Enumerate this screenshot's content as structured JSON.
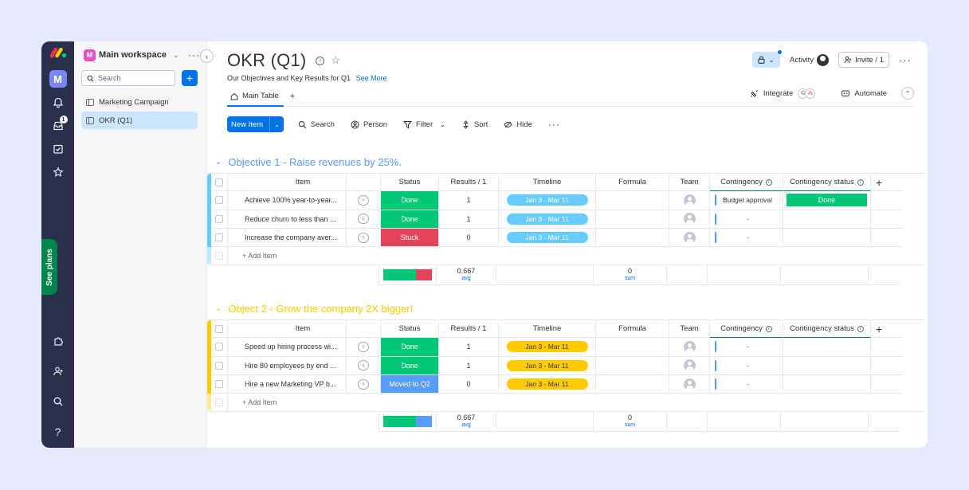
{
  "workspace": {
    "name": "Main workspace",
    "avatar_letter": "M",
    "search_placeholder": "Search",
    "boards": [
      {
        "label": "Marketing Campaign",
        "active": false
      },
      {
        "label": "OKR (Q1)",
        "active": true
      }
    ]
  },
  "rail": {
    "apps_letter": "M",
    "inbox_badge": "1",
    "see_plans": "See plans",
    "help": "?"
  },
  "board": {
    "title": "OKR (Q1)",
    "subtitle": "Our Objectives and Key Results for Q1",
    "see_more": "See More",
    "activity_label": "Activity",
    "invite_label": "Invite / 1",
    "tab_main": "Main Table",
    "integrate_label": "Integrate",
    "automate_label": "Automate"
  },
  "toolbar": {
    "new_item": "New Item",
    "search": "Search",
    "person": "Person",
    "filter": "Filter",
    "sort": "Sort",
    "hide": "Hide"
  },
  "columns": {
    "item": "Item",
    "status": "Status",
    "results": "Results / 1",
    "timeline": "Timeline",
    "formula": "Formula",
    "team": "Team",
    "contingency": "Contingency",
    "contingency_status": "Contingency status"
  },
  "colors": {
    "done": "#00c875",
    "stuck": "#e2445c",
    "moved": "#579bfc",
    "group1": "#66ccff",
    "group1_title": "#579bfc",
    "group2": "#ffcb00",
    "group2_title": "#ffcb00"
  },
  "groups": [
    {
      "title": "Objective 1 - Raise revenues by 25%.",
      "rows": [
        {
          "item": "Achieve 100% year-to-year...",
          "status": "Done",
          "results": "1",
          "timeline": "Jan 3 - Mar 11",
          "contingency": "Budget approval",
          "contingency_status": "Done"
        },
        {
          "item": "Reduce churn to less than ...",
          "status": "Done",
          "results": "1",
          "timeline": "Jan 3 - Mar 11",
          "contingency": "-",
          "contingency_status": ""
        },
        {
          "item": "Increase the company aver...",
          "status": "Stuck",
          "results": "0",
          "timeline": "Jan 3 - Mar 11",
          "contingency": "-",
          "contingency_status": ""
        }
      ],
      "add_item": "+ Add Item",
      "summary": {
        "results_value": "0.667",
        "results_label": "avg",
        "formula_value": "0",
        "formula_label": "sum",
        "status_share": {
          "Done": 0.67,
          "Stuck": 0.33
        }
      }
    },
    {
      "title": "Object 2 - Grow the company 2X bigger!",
      "rows": [
        {
          "item": "Speed up hiring process wi...",
          "status": "Done",
          "results": "1",
          "timeline": "Jan 3 - Mar 11",
          "contingency": "-",
          "contingency_status": ""
        },
        {
          "item": "Hire 80 employees by end ...",
          "status": "Done",
          "results": "1",
          "timeline": "Jan 3 - Mar 11",
          "contingency": "-",
          "contingency_status": ""
        },
        {
          "item": "Hire a new Marketing VP b...",
          "status": "Moved to Q2",
          "results": "0",
          "timeline": "Jan 3 - Mar 11",
          "contingency": "-",
          "contingency_status": ""
        }
      ],
      "add_item": "+ Add Item",
      "summary": {
        "results_value": "0.667",
        "results_label": "avg",
        "formula_value": "0",
        "formula_label": "sum",
        "status_share": {
          "Done": 0.67,
          "Moved to Q2": 0.33
        }
      }
    }
  ]
}
